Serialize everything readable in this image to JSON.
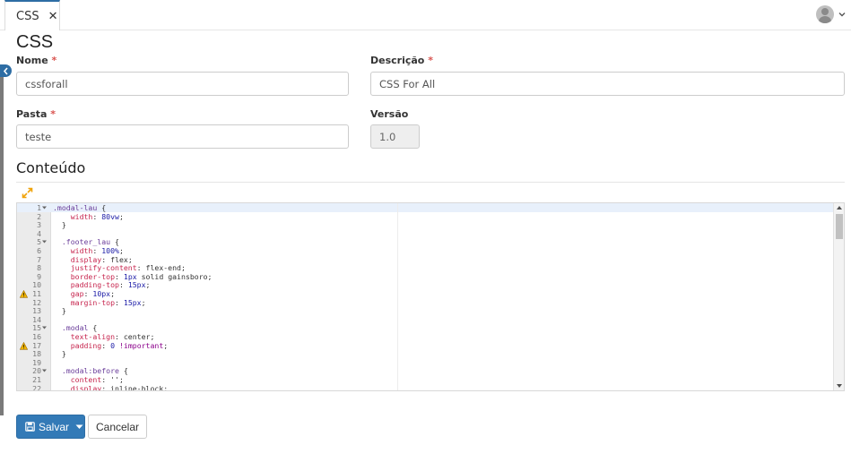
{
  "tab": {
    "label": "CSS",
    "close_label": "✕"
  },
  "page": {
    "title": "CSS"
  },
  "fields": {
    "nome": {
      "label": "Nome",
      "required_mark": "*",
      "value": "cssforall"
    },
    "descricao": {
      "label": "Descrição",
      "required_mark": "*",
      "value": "CSS For All"
    },
    "pasta": {
      "label": "Pasta",
      "required_mark": "*",
      "value": "teste"
    },
    "versao": {
      "label": "Versão",
      "value": "1.0"
    }
  },
  "content": {
    "title": "Conteúdo"
  },
  "editor": {
    "lines": [
      {
        "n": "1",
        "fold": true,
        "warn": false,
        "text": ".modal-lau {"
      },
      {
        "n": "2",
        "fold": false,
        "warn": false,
        "text": "    width: 80vw;"
      },
      {
        "n": "3",
        "fold": false,
        "warn": false,
        "text": "  }"
      },
      {
        "n": "4",
        "fold": false,
        "warn": false,
        "text": ""
      },
      {
        "n": "5",
        "fold": true,
        "warn": false,
        "text": "  .footer_lau {"
      },
      {
        "n": "6",
        "fold": false,
        "warn": false,
        "text": "    width: 100%;"
      },
      {
        "n": "7",
        "fold": false,
        "warn": false,
        "text": "    display: flex;"
      },
      {
        "n": "8",
        "fold": false,
        "warn": false,
        "text": "    justify-content: flex-end;"
      },
      {
        "n": "9",
        "fold": false,
        "warn": false,
        "text": "    border-top: 1px solid gainsboro;"
      },
      {
        "n": "10",
        "fold": false,
        "warn": false,
        "text": "    padding-top: 15px;"
      },
      {
        "n": "11",
        "fold": false,
        "warn": true,
        "text": "    gap: 10px;"
      },
      {
        "n": "12",
        "fold": false,
        "warn": false,
        "text": "    margin-top: 15px;"
      },
      {
        "n": "13",
        "fold": false,
        "warn": false,
        "text": "  }"
      },
      {
        "n": "14",
        "fold": false,
        "warn": false,
        "text": ""
      },
      {
        "n": "15",
        "fold": true,
        "warn": false,
        "text": "  .modal {"
      },
      {
        "n": "16",
        "fold": false,
        "warn": false,
        "text": "    text-align: center;"
      },
      {
        "n": "17",
        "fold": false,
        "warn": true,
        "text": "    padding: 0 !important;"
      },
      {
        "n": "18",
        "fold": false,
        "warn": false,
        "text": "  }"
      },
      {
        "n": "19",
        "fold": false,
        "warn": false,
        "text": ""
      },
      {
        "n": "20",
        "fold": true,
        "warn": false,
        "text": "  .modal:before {"
      },
      {
        "n": "21",
        "fold": false,
        "warn": false,
        "text": "    content: '';"
      },
      {
        "n": "22",
        "fold": false,
        "warn": false,
        "text": "    display: inline-block;"
      }
    ]
  },
  "actions": {
    "save_label": "Salvar",
    "cancel_label": "Cancelar"
  },
  "colors": {
    "primary": "#337ab7",
    "required": "#d9534f",
    "accent_icon": "#f0a30a"
  },
  "icons": {
    "close": "close-icon",
    "avatar": "user-avatar-icon",
    "expand": "expand-icon",
    "warning": "warning-icon",
    "save": "floppy-disk-icon"
  }
}
